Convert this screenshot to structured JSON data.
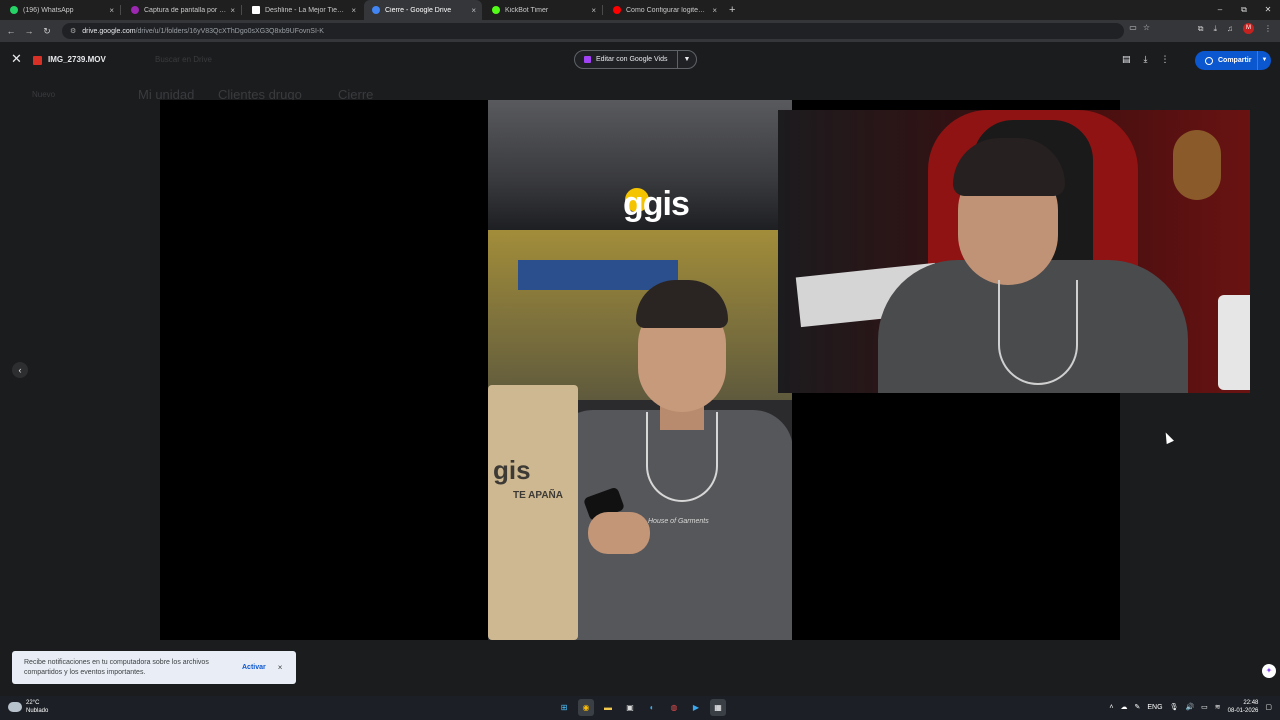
{
  "browser": {
    "tabs": [
      {
        "title": "(196) WhatsApp",
        "color": "#25d366",
        "active": false
      },
      {
        "title": "Captura de pantalla por Lightshot",
        "color": "#9c27b0",
        "active": false
      },
      {
        "title": "Deshline - La Mejor Tienda de",
        "color": "#ffffff",
        "active": false
      },
      {
        "title": "Cierre - Google Drive",
        "color": "#4285f4",
        "active": true
      },
      {
        "title": "KickBot Timer",
        "color": "#53fc18",
        "active": false
      },
      {
        "title": "Como Configurar logitech c920",
        "color": "#ff0000",
        "active": false
      }
    ],
    "close_glyph": "×",
    "new_tab_glyph": "+",
    "window_controls": [
      "–",
      "⧉",
      "✕"
    ],
    "url_host": "drive.google.com",
    "url_path": "/drive/u/1/folders/16yV83QcXThDgo0sXG3Q8xb9UFovnSI-K",
    "avatar_letter": "M"
  },
  "viewer": {
    "file_name": "IMG_2739.MOV",
    "edit_button_label": "Editar con Google Vids",
    "share_button_label": "Compartir",
    "prev_glyph": "‹"
  },
  "video": {
    "bag_text": "gis",
    "bag_subtext": "TE APAÑA",
    "store_sign": "ggis",
    "shirt_print": "House of Garments"
  },
  "drive_background": {
    "new_button": "Nuevo",
    "breadcrumb": [
      "Mi unidad",
      "Clientes drugo",
      "Cierre"
    ],
    "search_placeholder": "Buscar en Drive"
  },
  "notification": {
    "message": "Recibe notificaciones en tu computadora sobre los archivos compartidos y los eventos importantes.",
    "action_label": "Activar",
    "close_glyph": "×"
  },
  "taskbar": {
    "weather_temp": "22°C",
    "weather_desc": "Nublado",
    "language": "ENG",
    "time": "22:48",
    "date": "08-01-2026"
  }
}
